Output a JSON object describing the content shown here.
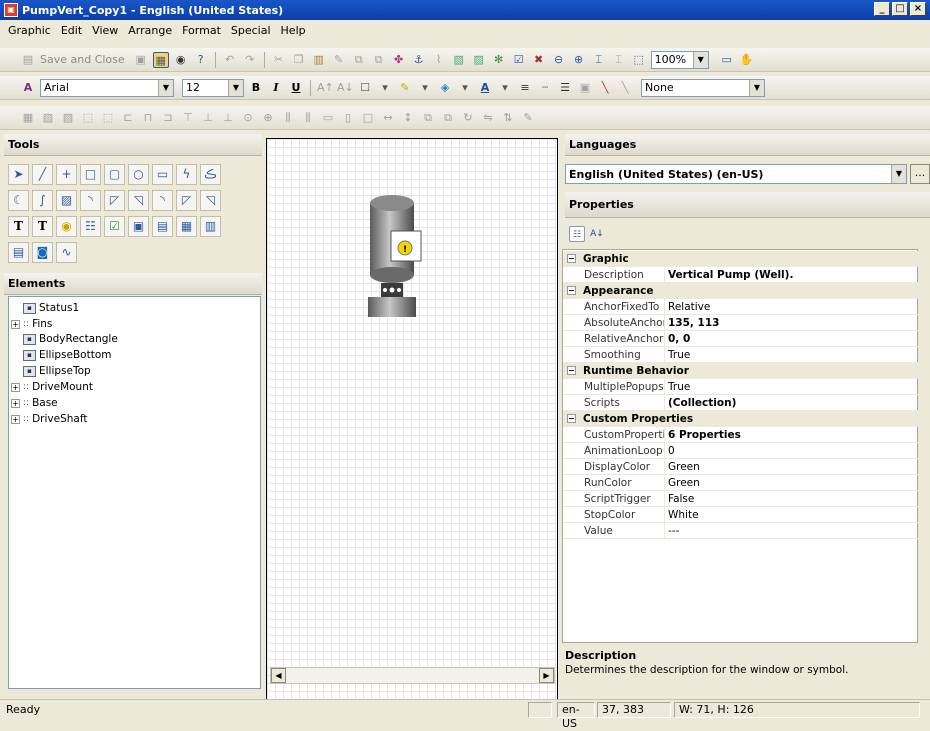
{
  "window": {
    "title": "PumpVert_Copy1 - English (United States)",
    "buttons": [
      "_",
      "□",
      "×"
    ]
  },
  "menu": [
    "Graphic",
    "Edit",
    "View",
    "Arrange",
    "Format",
    "Special",
    "Help"
  ],
  "toolbar1": {
    "save_close_label": "Save and Close",
    "zoom": "100%"
  },
  "toolbar2": {
    "font": "Arial",
    "size": "12",
    "bold": "B",
    "italic": "I",
    "underline": "U",
    "line_style": "None"
  },
  "tools_panel": {
    "title": "Tools"
  },
  "elements_panel": {
    "title": "Elements",
    "items": [
      {
        "label": "Status1",
        "expandable": false
      },
      {
        "label": "Fins",
        "expandable": true
      },
      {
        "label": "BodyRectangle",
        "expandable": false
      },
      {
        "label": "EllipseBottom",
        "expandable": false
      },
      {
        "label": "EllipseTop",
        "expandable": false
      },
      {
        "label": "DriveMount",
        "expandable": true
      },
      {
        "label": "Base",
        "expandable": true
      },
      {
        "label": "DriveShaft",
        "expandable": true
      }
    ]
  },
  "languages": {
    "title": "Languages",
    "selected": "English (United States) (en-US)",
    "more": "..."
  },
  "properties": {
    "title": "Properties",
    "rows": [
      {
        "cat": true,
        "name": "Graphic"
      },
      {
        "name": "Description",
        "value": "Vertical Pump (Well).",
        "bold": true
      },
      {
        "cat": true,
        "name": "Appearance"
      },
      {
        "name": "AnchorFixedTo",
        "value": "Relative"
      },
      {
        "name": "AbsoluteAnchor",
        "value": "135, 113",
        "bold": true
      },
      {
        "name": "RelativeAnchor",
        "value": "0, 0",
        "bold": true
      },
      {
        "name": "Smoothing",
        "value": "True"
      },
      {
        "cat": true,
        "name": "Runtime Behavior"
      },
      {
        "name": "MultiplePopups",
        "value": "True"
      },
      {
        "name": "Scripts",
        "value": "(Collection)",
        "bold": true
      },
      {
        "cat": true,
        "name": "Custom Properties"
      },
      {
        "name": "CustomProperties",
        "value": "6 Properties",
        "bold": true
      },
      {
        "name": "AnimationLoop",
        "value": "0"
      },
      {
        "name": "DisplayColor",
        "value": "Green"
      },
      {
        "name": "RunColor",
        "value": "Green"
      },
      {
        "name": "ScriptTrigger",
        "value": "False"
      },
      {
        "name": "StopColor",
        "value": "White"
      },
      {
        "name": "Value",
        "value": "---"
      }
    ],
    "desc_title": "Description",
    "desc_text": "Determines the description for the window or symbol."
  },
  "status": {
    "ready": "Ready",
    "locale": "en-US",
    "coords": "37, 383",
    "size": "W: 71, H: 126"
  }
}
